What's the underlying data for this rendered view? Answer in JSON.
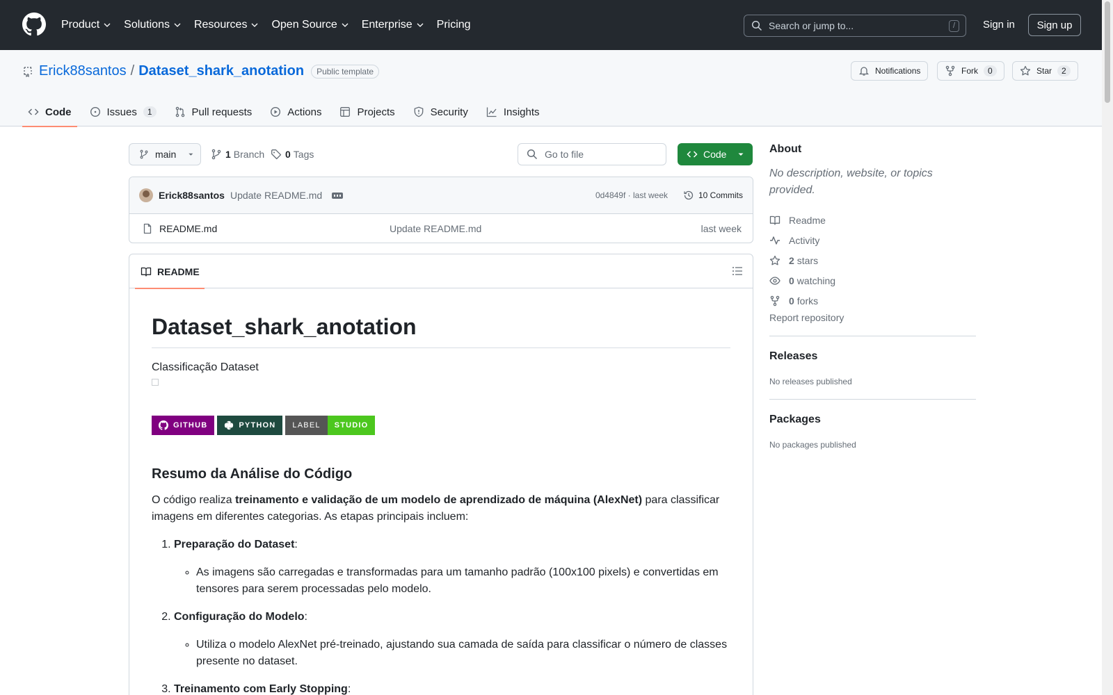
{
  "header": {
    "nav": [
      "Product",
      "Solutions",
      "Resources",
      "Open Source",
      "Enterprise",
      "Pricing"
    ],
    "search_placeholder": "Search or jump to...",
    "search_shortcut": "/",
    "sign_in": "Sign in",
    "sign_up": "Sign up"
  },
  "repo": {
    "owner": "Erick88santos",
    "separator": "/",
    "name": "Dataset_shark_anotation",
    "visibility": "Public template",
    "notifications_label": "Notifications",
    "fork_label": "Fork",
    "fork_count": "0",
    "star_label": "Star",
    "star_count": "2"
  },
  "tabs": [
    {
      "label": "Code"
    },
    {
      "label": "Issues",
      "count": "1"
    },
    {
      "label": "Pull requests"
    },
    {
      "label": "Actions"
    },
    {
      "label": "Projects"
    },
    {
      "label": "Security"
    },
    {
      "label": "Insights"
    }
  ],
  "branchbar": {
    "branch": "main",
    "branch_count": "1",
    "branch_label": "Branch",
    "tag_count": "0",
    "tag_label": "Tags",
    "goto_placeholder": "Go to file",
    "code_button": "Code"
  },
  "commit": {
    "author": "Erick88santos",
    "message": "Update README.md",
    "hash_age": "0d4849f · last week",
    "commits": "10 Commits"
  },
  "files": [
    {
      "name": "README.md",
      "message": "Update README.md",
      "age": "last week"
    }
  ],
  "readme": {
    "tab_label": "README",
    "title": "Dataset_shark_anotation",
    "subtitle": "Classificação Dataset",
    "badges": {
      "github": "GITHUB",
      "python": "PYTHON",
      "label": "LABEL",
      "studio": "STUDIO"
    },
    "colors": {
      "github": "#800080",
      "python": "#1e4a3f",
      "label": "#555555",
      "studio": "#4cc71e"
    },
    "h2": "Resumo da Análise do Código",
    "intro_before": "O código realiza ",
    "intro_bold": "treinamento e validação de um modelo de aprendizado de máquina (AlexNet)",
    "intro_after": " para classificar imagens em diferentes categorias. As etapas principais incluem:",
    "steps": [
      {
        "title": "Preparação do Dataset",
        "suffix": ":",
        "detail": "As imagens são carregadas e transformadas para um tamanho padrão (100x100 pixels) e convertidas em tensores para serem processadas pelo modelo."
      },
      {
        "title": "Configuração do Modelo",
        "suffix": ":",
        "detail": "Utiliza o modelo AlexNet pré-treinado, ajustando sua camada de saída para classificar o número de classes presente no dataset."
      },
      {
        "title": "Treinamento com Early Stopping",
        "suffix": ":",
        "detail": ""
      }
    ]
  },
  "about": {
    "heading": "About",
    "description": "No description, website, or topics provided.",
    "readme": "Readme",
    "activity": "Activity",
    "stars_count": "2",
    "stars_label": "stars",
    "watching_count": "0",
    "watching_label": "watching",
    "forks_count": "0",
    "forks_label": "forks",
    "report": "Report repository"
  },
  "releases": {
    "heading": "Releases",
    "empty": "No releases published"
  },
  "packages": {
    "heading": "Packages",
    "empty": "No packages published"
  }
}
